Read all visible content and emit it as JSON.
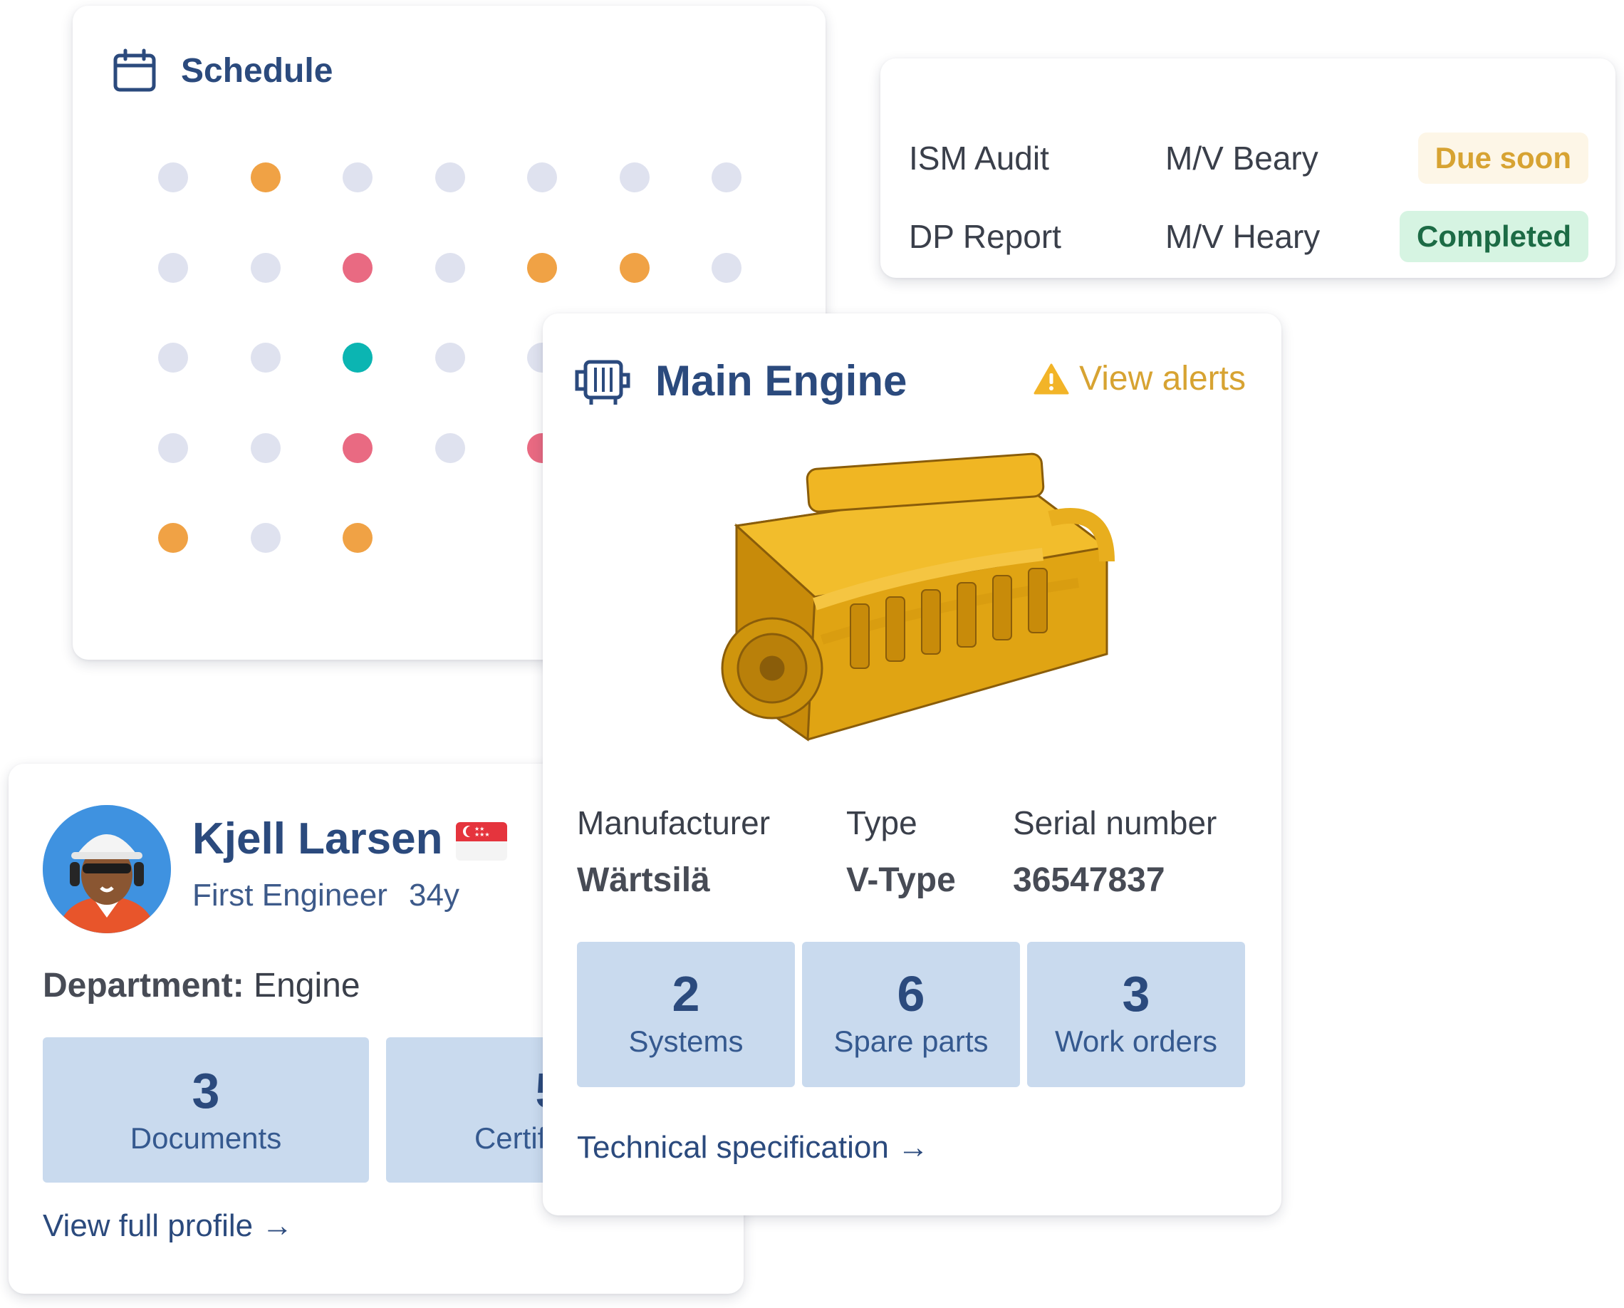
{
  "schedule": {
    "title": "Schedule",
    "icon": "calendar-icon",
    "dot_colors": {
      "empty": "#dfe2ef",
      "orange": "#f0a245",
      "red": "#e96a82",
      "teal": "#0bb5b2"
    },
    "grid": [
      [
        "empty",
        "orange",
        "empty",
        "empty",
        "empty",
        "empty",
        "empty"
      ],
      [
        "empty",
        "empty",
        "red",
        "empty",
        "orange",
        "orange",
        "empty"
      ],
      [
        "empty",
        "empty",
        "teal",
        "empty",
        "empty",
        "empty",
        "empty"
      ],
      [
        "empty",
        "empty",
        "red",
        "empty",
        "red",
        "empty",
        "empty"
      ],
      [
        "orange",
        "empty",
        "orange"
      ]
    ]
  },
  "tasks": [
    {
      "name": "ISM Audit",
      "vessel": "M/V Beary",
      "status": "Due soon",
      "status_kind": "due"
    },
    {
      "name": "DP Report",
      "vessel": "M/V Heary",
      "status": "Completed",
      "status_kind": "done"
    }
  ],
  "profile": {
    "name": "Kjell Larsen",
    "flag": "singapore-flag",
    "role": "First Engineer",
    "age": "34y",
    "department_label": "Department:",
    "department_value": "Engine",
    "stats": [
      {
        "value": "3",
        "label": "Documents"
      },
      {
        "value": "5",
        "label": "Certificates"
      }
    ],
    "link": "View full profile →"
  },
  "engine": {
    "title": "Main Engine",
    "icon": "engine-icon",
    "alerts_label": "View alerts",
    "alerts_icon": "warning-icon",
    "specs": [
      {
        "key": "Manufacturer",
        "value": "Wärtsilä"
      },
      {
        "key": "Type",
        "value": "V-Type"
      },
      {
        "key": "Serial number",
        "value": "36547837"
      }
    ],
    "stats": [
      {
        "value": "2",
        "label": "Systems"
      },
      {
        "value": "6",
        "label": "Spare parts"
      },
      {
        "value": "3",
        "label": "Work orders"
      }
    ],
    "link": "Technical specification →"
  }
}
